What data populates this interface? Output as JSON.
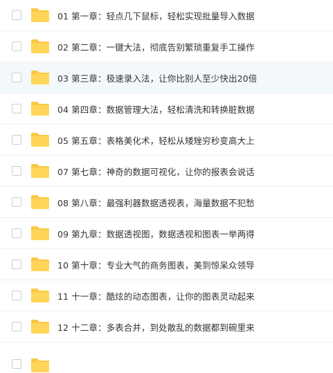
{
  "colors": {
    "folder": "#FFD659",
    "folder_tab": "#F9C743",
    "highlight": "#F3F8FD",
    "text": "#333333"
  },
  "rows": [
    {
      "label": "01 第一章：轻点几下鼠标，轻松实现批量导入数据",
      "icon": "folder-icon"
    },
    {
      "label": "02 第二章：一键大法，彻底告别繁琐重复手工操作",
      "icon": "folder-icon"
    },
    {
      "label": "03 第三章：极速录入法，让你比别人至少快出20倍",
      "icon": "folder-icon"
    },
    {
      "label": "04 第四章：数据管理大法，轻松清洗和转换脏数据",
      "icon": "folder-icon"
    },
    {
      "label": "05 第五章：表格美化术，轻松从矮矬穷秒变高大上",
      "icon": "folder-icon"
    },
    {
      "label": "07 第七章：神奇的数据可视化，让你的报表会说话",
      "icon": "folder-icon"
    },
    {
      "label": "08 第八章：最强利器数据透视表，海量数据不犯愁",
      "icon": "folder-icon"
    },
    {
      "label": "09 第九章：数据透视图，数据透视和图表一举两得",
      "icon": "folder-icon"
    },
    {
      "label": "10 第十章：专业大气的商务图表，美到惊呆众领导",
      "icon": "folder-icon"
    },
    {
      "label": "11 十一章：酷炫的动态图表，让你的图表灵动起来",
      "icon": "folder-icon"
    },
    {
      "label": "12 十二章：多表合并，到处散乱的数据都到碗里来",
      "icon": "folder-icon"
    },
    {
      "label": "",
      "icon": "folder-icon"
    }
  ]
}
